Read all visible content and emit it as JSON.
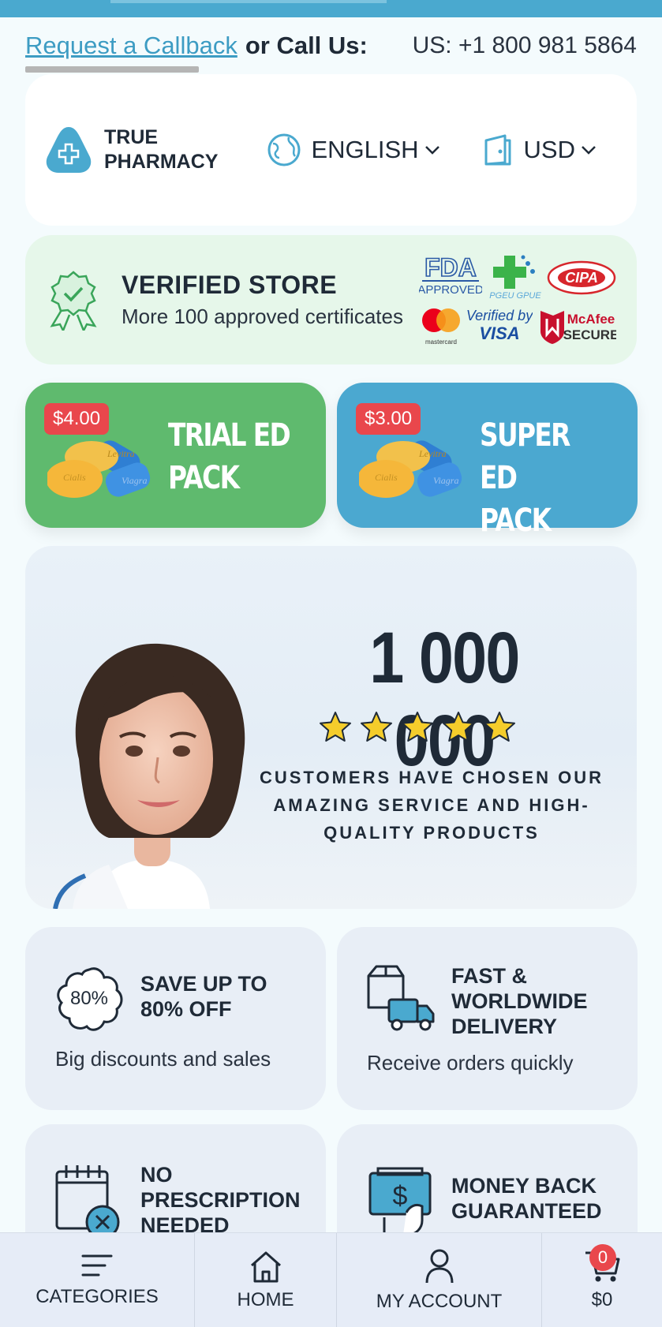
{
  "topbar": {
    "callback_link": "Request a Callback",
    "call_us_label": "or Call Us:",
    "phone": "US: +1 800 981 5864"
  },
  "header": {
    "logo_line1": "TRUE",
    "logo_line2": "PHARMACY",
    "language": "ENGLISH",
    "currency": "USD"
  },
  "verified": {
    "title": "VERIFIED STORE",
    "subtitle": "More 100 approved certificates",
    "badges": {
      "fda_top": "FDA",
      "fda_bottom": "APPROVED",
      "pgeu": "PGEU GPUE",
      "cipa": "CIPA",
      "mastercard": "mastercard",
      "visa_top": "Verified by",
      "visa_bottom": "VISA",
      "mcafee_top": "McAfee",
      "mcafee_bottom": "SECURE"
    }
  },
  "packs": [
    {
      "price": "$4.00",
      "line1": "TRIAL ED",
      "line2": "PACK",
      "pill_labels": [
        "Levitra",
        "Cialis",
        "Viagra"
      ]
    },
    {
      "price": "$3.00",
      "line1": "SUPER ED",
      "line2": "PACK",
      "pill_labels": [
        "Levitra",
        "Cialis",
        "Viagra"
      ]
    }
  ],
  "hero": {
    "number": "1 000 000",
    "stars": 5,
    "line1": "CUSTOMERS HAVE CHOSEN OUR",
    "line2": "AMAZING SERVICE AND HIGH-",
    "line3": "QUALITY PRODUCTS"
  },
  "features": [
    {
      "icon": "discount-cloud-icon",
      "icon_text": "80%",
      "title_lines": [
        "SAVE UP TO",
        "80% OFF"
      ],
      "subtitle": "Big discounts and sales"
    },
    {
      "icon": "delivery-truck-icon",
      "title_lines": [
        "FAST &",
        "WORLDWIDE",
        "DELIVERY"
      ],
      "subtitle": "Receive orders quickly"
    },
    {
      "icon": "no-prescription-calendar-icon",
      "title_lines": [
        "NO",
        "PRESCRIPTION",
        "NEEDED"
      ],
      "subtitle": ""
    },
    {
      "icon": "money-back-hand-icon",
      "title_lines": [
        "MONEY BACK",
        "GUARANTEED"
      ],
      "subtitle": ""
    }
  ],
  "bottom_nav": {
    "categories": "CATEGORIES",
    "home": "HOME",
    "account": "MY ACCOUNT",
    "cart_total": "$0",
    "cart_count": "0"
  },
  "colors": {
    "accent_blue": "#4aa9cf",
    "green_pack": "#5fba6e",
    "blue_pack": "#4ba8d0",
    "badge_red": "#e9474c"
  }
}
